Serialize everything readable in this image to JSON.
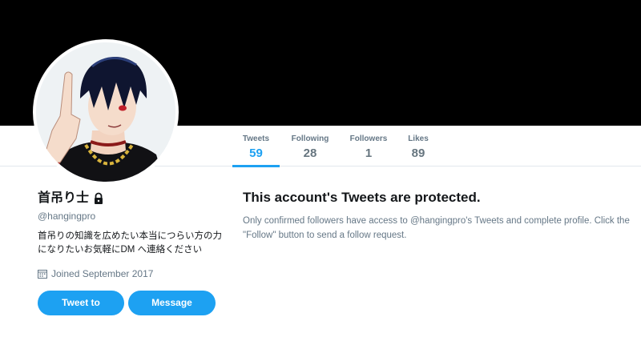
{
  "profile": {
    "name": "首吊り士",
    "handle": "@hangingpro",
    "bio": "首吊りの知識を広めたい本当につらい方の力になりたいお気軽にDM へ連絡ください",
    "joined": "Joined September 2017"
  },
  "stats": [
    {
      "label": "Tweets",
      "value": "59"
    },
    {
      "label": "Following",
      "value": "28"
    },
    {
      "label": "Followers",
      "value": "1"
    },
    {
      "label": "Likes",
      "value": "89"
    }
  ],
  "buttons": {
    "tweet_to": "Tweet to",
    "message": "Message"
  },
  "protected": {
    "title": "This account's Tweets are protected.",
    "body": "Only confirmed followers have access to @hangingpro's Tweets and complete profile. Click the \"Follow\" button to send a follow request."
  },
  "colors": {
    "accent": "#1da1f2",
    "banner": "#000000"
  },
  "icons": {
    "lock": "lock-icon",
    "calendar": "calendar-icon"
  }
}
